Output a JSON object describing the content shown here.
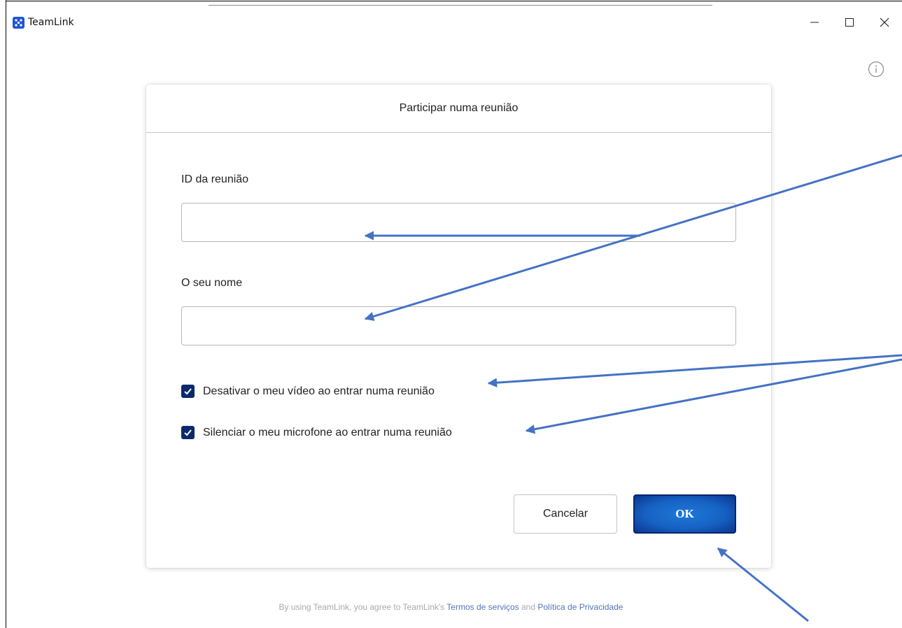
{
  "app": {
    "title": "TeamLink",
    "logo_icon": "teamlink-logo-icon",
    "brand_color": "#1e56d6"
  },
  "window_controls": {
    "minimize_icon": "minimize-icon",
    "maximize_icon": "maximize-icon",
    "close_icon": "close-icon"
  },
  "info_icon": "info-icon",
  "dialog": {
    "title": "Participar numa reunião",
    "meeting_id": {
      "label": "ID da reunião",
      "value": "",
      "placeholder": ""
    },
    "name": {
      "label": "O seu nome",
      "value": "",
      "placeholder": ""
    },
    "options": [
      {
        "label": "Desativar o meu vídeo ao entrar numa reunião",
        "checked": true
      },
      {
        "label": "Silenciar o meu microfone ao entrar numa reunião",
        "checked": true
      }
    ],
    "cancel_label": "Cancelar",
    "ok_label": "OK",
    "ok_color": "#1662c4",
    "checkbox_color": "#0b2a6b"
  },
  "footer": {
    "prefix": "By using TeamLink, you agree to TeamLink's ",
    "terms_link": "Termos de serviços",
    "conjunction": " and ",
    "privacy_link": "Política de Privacidade"
  },
  "annotation_color": "#4472c4"
}
